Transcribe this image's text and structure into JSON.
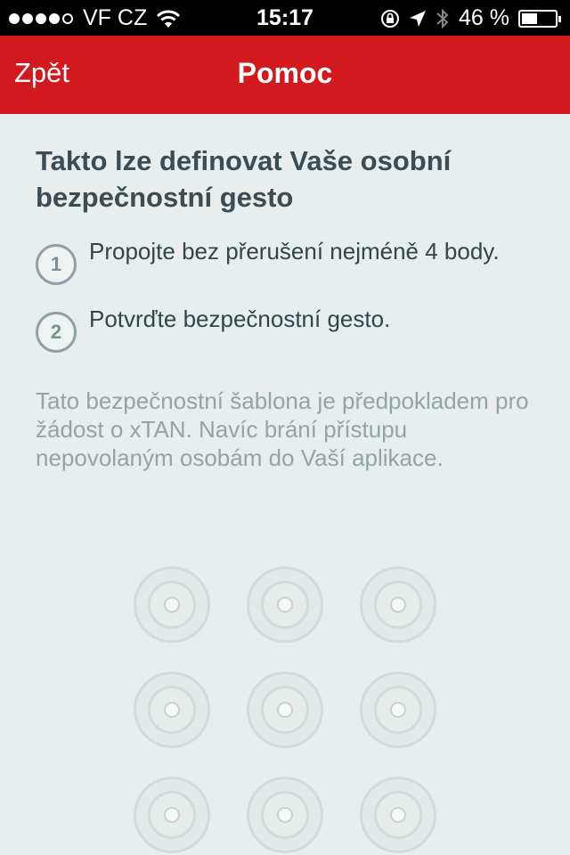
{
  "status_bar": {
    "carrier": "VF CZ",
    "time": "15:17",
    "battery_text": "46 %",
    "battery_level": 0.46,
    "signal_bars": 4,
    "signal_max": 5
  },
  "nav": {
    "back_label": "Zpět",
    "title": "Pomoc"
  },
  "help": {
    "heading": "Takto lze definovat Vaše osobní bezpečnostní gesto",
    "steps": [
      {
        "number": "1",
        "text": "Propojte bez přerušení nejméně 4 body."
      },
      {
        "number": "2",
        "text": "Potvrďte bezpečnostní gesto."
      }
    ],
    "description": "Tato bezpečnostní šablona je předpokladem pro žádost o xTAN. Navíc brání přístupu nepovolaným osobám do Vaší aplikace."
  },
  "colors": {
    "nav_bar": "#d2191e",
    "background": "#e8eeed",
    "heading_text": "#3c4c52",
    "muted_text": "#93a3a8"
  },
  "icons": {
    "wifi": "wifi-icon",
    "orientation_lock": "orientation-lock-icon",
    "location": "location-arrow-icon",
    "bluetooth": "bluetooth-icon",
    "battery": "battery-icon"
  },
  "pattern": {
    "rows": 3,
    "cols": 3
  }
}
